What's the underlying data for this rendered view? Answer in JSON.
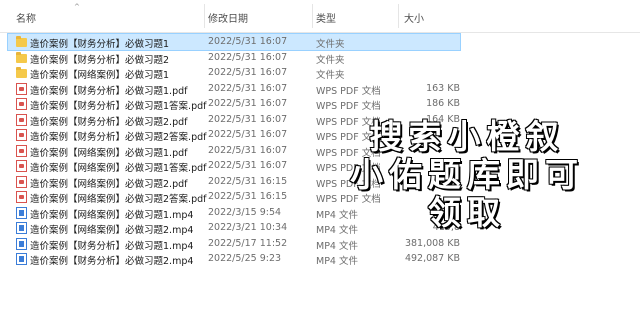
{
  "header": {
    "name": "名称",
    "date": "修改日期",
    "type": "类型",
    "size": "大小"
  },
  "files": [
    {
      "icon": "folder-icon",
      "name": "造价案例【财务分析】必做习题1",
      "date": "2022/5/31 16:07",
      "type": "文件夹",
      "size": "",
      "selected": true
    },
    {
      "icon": "folder-icon",
      "name": "造价案例【财务分析】必做习题2",
      "date": "2022/5/31 16:07",
      "type": "文件夹",
      "size": ""
    },
    {
      "icon": "folder-icon",
      "name": "造价案例【网络案例】必做习题1",
      "date": "2022/5/31 16:07",
      "type": "文件夹",
      "size": ""
    },
    {
      "icon": "pdf-icon",
      "name": "造价案例【财务分析】必做习题1.pdf",
      "date": "2022/5/31 16:07",
      "type": "WPS PDF 文档",
      "size": "163 KB"
    },
    {
      "icon": "pdf-icon",
      "name": "造价案例【财务分析】必做习题1答案.pdf",
      "date": "2022/5/31 16:07",
      "type": "WPS PDF 文档",
      "size": "186 KB"
    },
    {
      "icon": "pdf-icon",
      "name": "造价案例【财务分析】必做习题2.pdf",
      "date": "2022/5/31 16:07",
      "type": "WPS PDF 文档",
      "size": "164 KB"
    },
    {
      "icon": "pdf-icon",
      "name": "造价案例【财务分析】必做习题2答案.pdf",
      "date": "2022/5/31 16:07",
      "type": "WPS PDF 文档",
      "size": ""
    },
    {
      "icon": "pdf-icon",
      "name": "造价案例【网络案例】必做习题1.pdf",
      "date": "2022/5/31 16:07",
      "type": "WPS PDF 文档",
      "size": ""
    },
    {
      "icon": "pdf-icon",
      "name": "造价案例【网络案例】必做习题1答案.pdf",
      "date": "2022/5/31 16:07",
      "type": "WPS PDF 文档",
      "size": ""
    },
    {
      "icon": "pdf-icon",
      "name": "造价案例【网络案例】必做习题2.pdf",
      "date": "2022/5/31 16:15",
      "type": "WPS PDF 文档",
      "size": ""
    },
    {
      "icon": "pdf-icon",
      "name": "造价案例【网络案例】必做习题2答案.pdf",
      "date": "2022/5/31 16:15",
      "type": "WPS PDF 文档",
      "size": ""
    },
    {
      "icon": "mp4-icon",
      "name": "造价案例【网络案例】必做习题1.mp4",
      "date": "2022/3/15 9:54",
      "type": "MP4 文件",
      "size": "468,8"
    },
    {
      "icon": "mp4-icon",
      "name": "造价案例【网络案例】必做习题2.mp4",
      "date": "2022/3/21 10:34",
      "type": "MP4 文件",
      "size": "415,8"
    },
    {
      "icon": "mp4-icon",
      "name": "造价案例【财务分析】必做习题1.mp4",
      "date": "2022/5/17 11:52",
      "type": "MP4 文件",
      "size": "381,008 KB"
    },
    {
      "icon": "mp4-icon",
      "name": "造价案例【财务分析】必做习题2.mp4",
      "date": "2022/5/25 9:23",
      "type": "MP4 文件",
      "size": "492,087 KB"
    }
  ],
  "overlay": {
    "line1": "搜索小橙叙",
    "line2": "小佑题库即可",
    "line3": "领取"
  },
  "colors": {
    "selected_bg": "#cce8ff",
    "folder": "#f5c94a",
    "pdf": "#d9534f",
    "mp4": "#3b7dd8"
  }
}
